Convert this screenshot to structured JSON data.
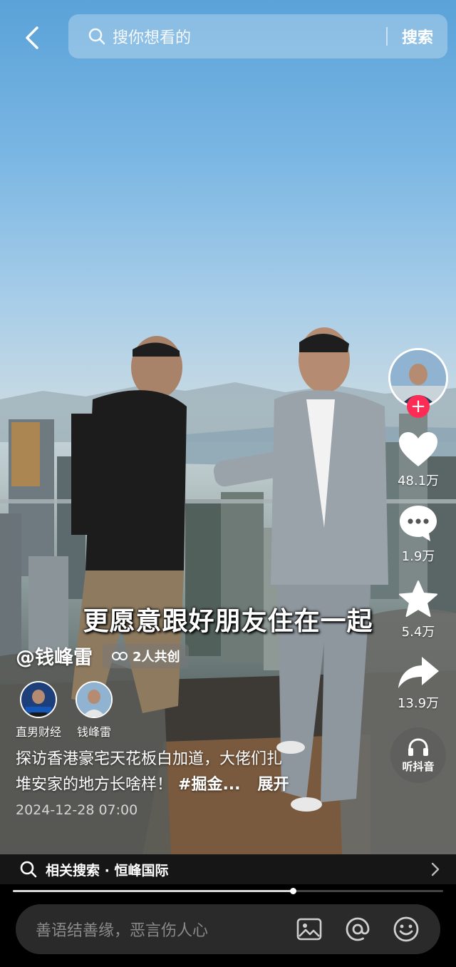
{
  "search": {
    "placeholder": "搜你想看的",
    "submit_label": "搜索"
  },
  "video": {
    "overlay_caption": "更愿意跟好朋友住在一起"
  },
  "actions": {
    "like_count": "48.1万",
    "comment_count": "1.9万",
    "favorite_count": "5.4万",
    "share_count": "13.9万",
    "listen_label": "听抖音"
  },
  "author": {
    "name": "@钱峰雷",
    "cocreate_label": "2人共创",
    "creators": [
      {
        "name": "直男财经"
      },
      {
        "name": "钱峰雷"
      }
    ]
  },
  "description": {
    "line1": "探访香港豪宅天花板白加道，大佬们扎",
    "line2_text": "堆安家的地方长啥样！",
    "hashtag": "#掘金...",
    "expand_label": "展开",
    "time": "2024-12-28 07:00"
  },
  "related": {
    "text": "相关搜索 · 恒峰国际"
  },
  "playback": {
    "progress": 0.65
  },
  "comment": {
    "placeholder": "善语结善缘，恶言伤人心"
  },
  "colors": {
    "follow_accent": "#fe2c55"
  }
}
